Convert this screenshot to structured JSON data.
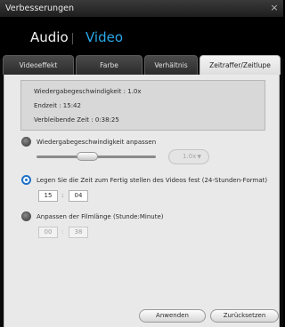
{
  "window": {
    "title": "Verbesserungen",
    "close_glyph": "×"
  },
  "header": {
    "audio_label": "Audio",
    "video_label": "Video",
    "active_mode": "Video",
    "accent_color": "#2aa7e8"
  },
  "tabs": [
    {
      "label": "Videoeffekt",
      "active": false
    },
    {
      "label": "Farbe",
      "active": false
    },
    {
      "label": "Verhältnis",
      "active": false
    },
    {
      "label": "Zeitraffer/Zeitlupe",
      "active": true
    }
  ],
  "info": {
    "speed": "Wiedergabegeschwindigkeit : 1.0x",
    "end_time": "Endzeit : 15:42",
    "remaining_time": "Verbleibende Zeit : 0:38:25"
  },
  "options": {
    "adjust_speed": {
      "label": "Wiedergabegeschwindigkeit anpassen",
      "selected": false,
      "dropdown_value": "1.0x"
    },
    "finish_time": {
      "label": "Legen Sie die Zeit zum Fertig stellen des Videos fest (24-Stunden-Format)",
      "selected": true,
      "hours": "15",
      "minutes": "04",
      "separator": ":"
    },
    "film_length": {
      "label": "Anpassen der Filmlänge (Stunde:Minute)",
      "selected": false,
      "hours": "00",
      "minutes": "38",
      "separator": ":"
    }
  },
  "buttons": {
    "apply": "Anwenden",
    "reset": "Zurücksetzen"
  }
}
